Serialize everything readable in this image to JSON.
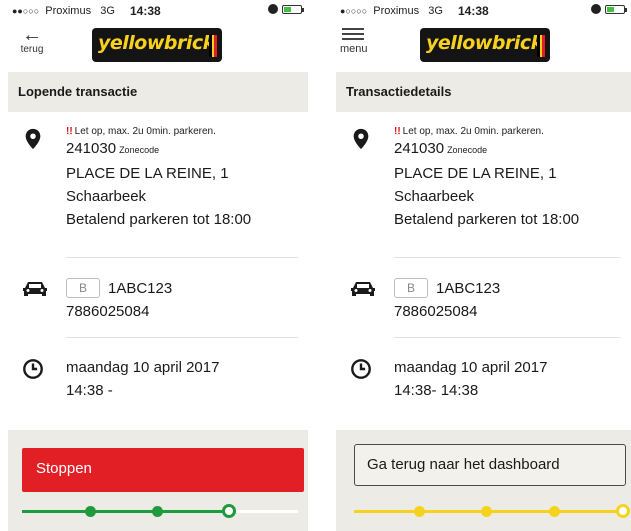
{
  "status_bar": {
    "signal": "●●○○○",
    "carrier": "Proximus",
    "network": "3G",
    "time": "14:38"
  },
  "right_signal": "●○○○○",
  "brand": {
    "logo_text": "yellowbrick",
    "logo_text_color": "#f7d11e",
    "flag_colors": [
      "#000000",
      "#f7d11e",
      "#e31f26"
    ]
  },
  "left": {
    "back_label": "terug",
    "header": "Lopende transactie",
    "warning": "Let op, max. 2u 0min. parkeren.",
    "zone_code": "241030",
    "zone_label": "Zonecode",
    "address": "PLACE DE LA REINE, 1",
    "city": "Schaarbeek",
    "parking_info": "Betalend parkeren tot 18:00",
    "plate_country": "B",
    "plate": "1ABC123",
    "phone": "7886025084",
    "date": "maandag 10 april 2017",
    "time": "14:38 -",
    "stop_button": "Stoppen",
    "stop_color": "#e31f26",
    "progress_color": "#1f9a3c"
  },
  "right": {
    "menu_label": "menu",
    "header": "Transactiedetails",
    "warning": "Let op, max. 2u 0min. parkeren.",
    "zone_code": "241030",
    "zone_label": "Zonecode",
    "address": "PLACE DE LA REINE, 1",
    "city": "Schaarbeek",
    "parking_info": "Betalend parkeren tot 18:00",
    "plate_country": "B",
    "plate": "1ABC123",
    "phone": "7886025084",
    "date": "maandag 10 april 2017",
    "time": "14:38- 14:38",
    "dashboard_button": "Ga terug naar het dashboard",
    "progress_color": "#f5d31c"
  },
  "icons": [
    "location-pin-icon",
    "car-icon",
    "clock-icon",
    "back-arrow-icon",
    "menu-icon",
    "alarm-icon",
    "battery-icon"
  ]
}
